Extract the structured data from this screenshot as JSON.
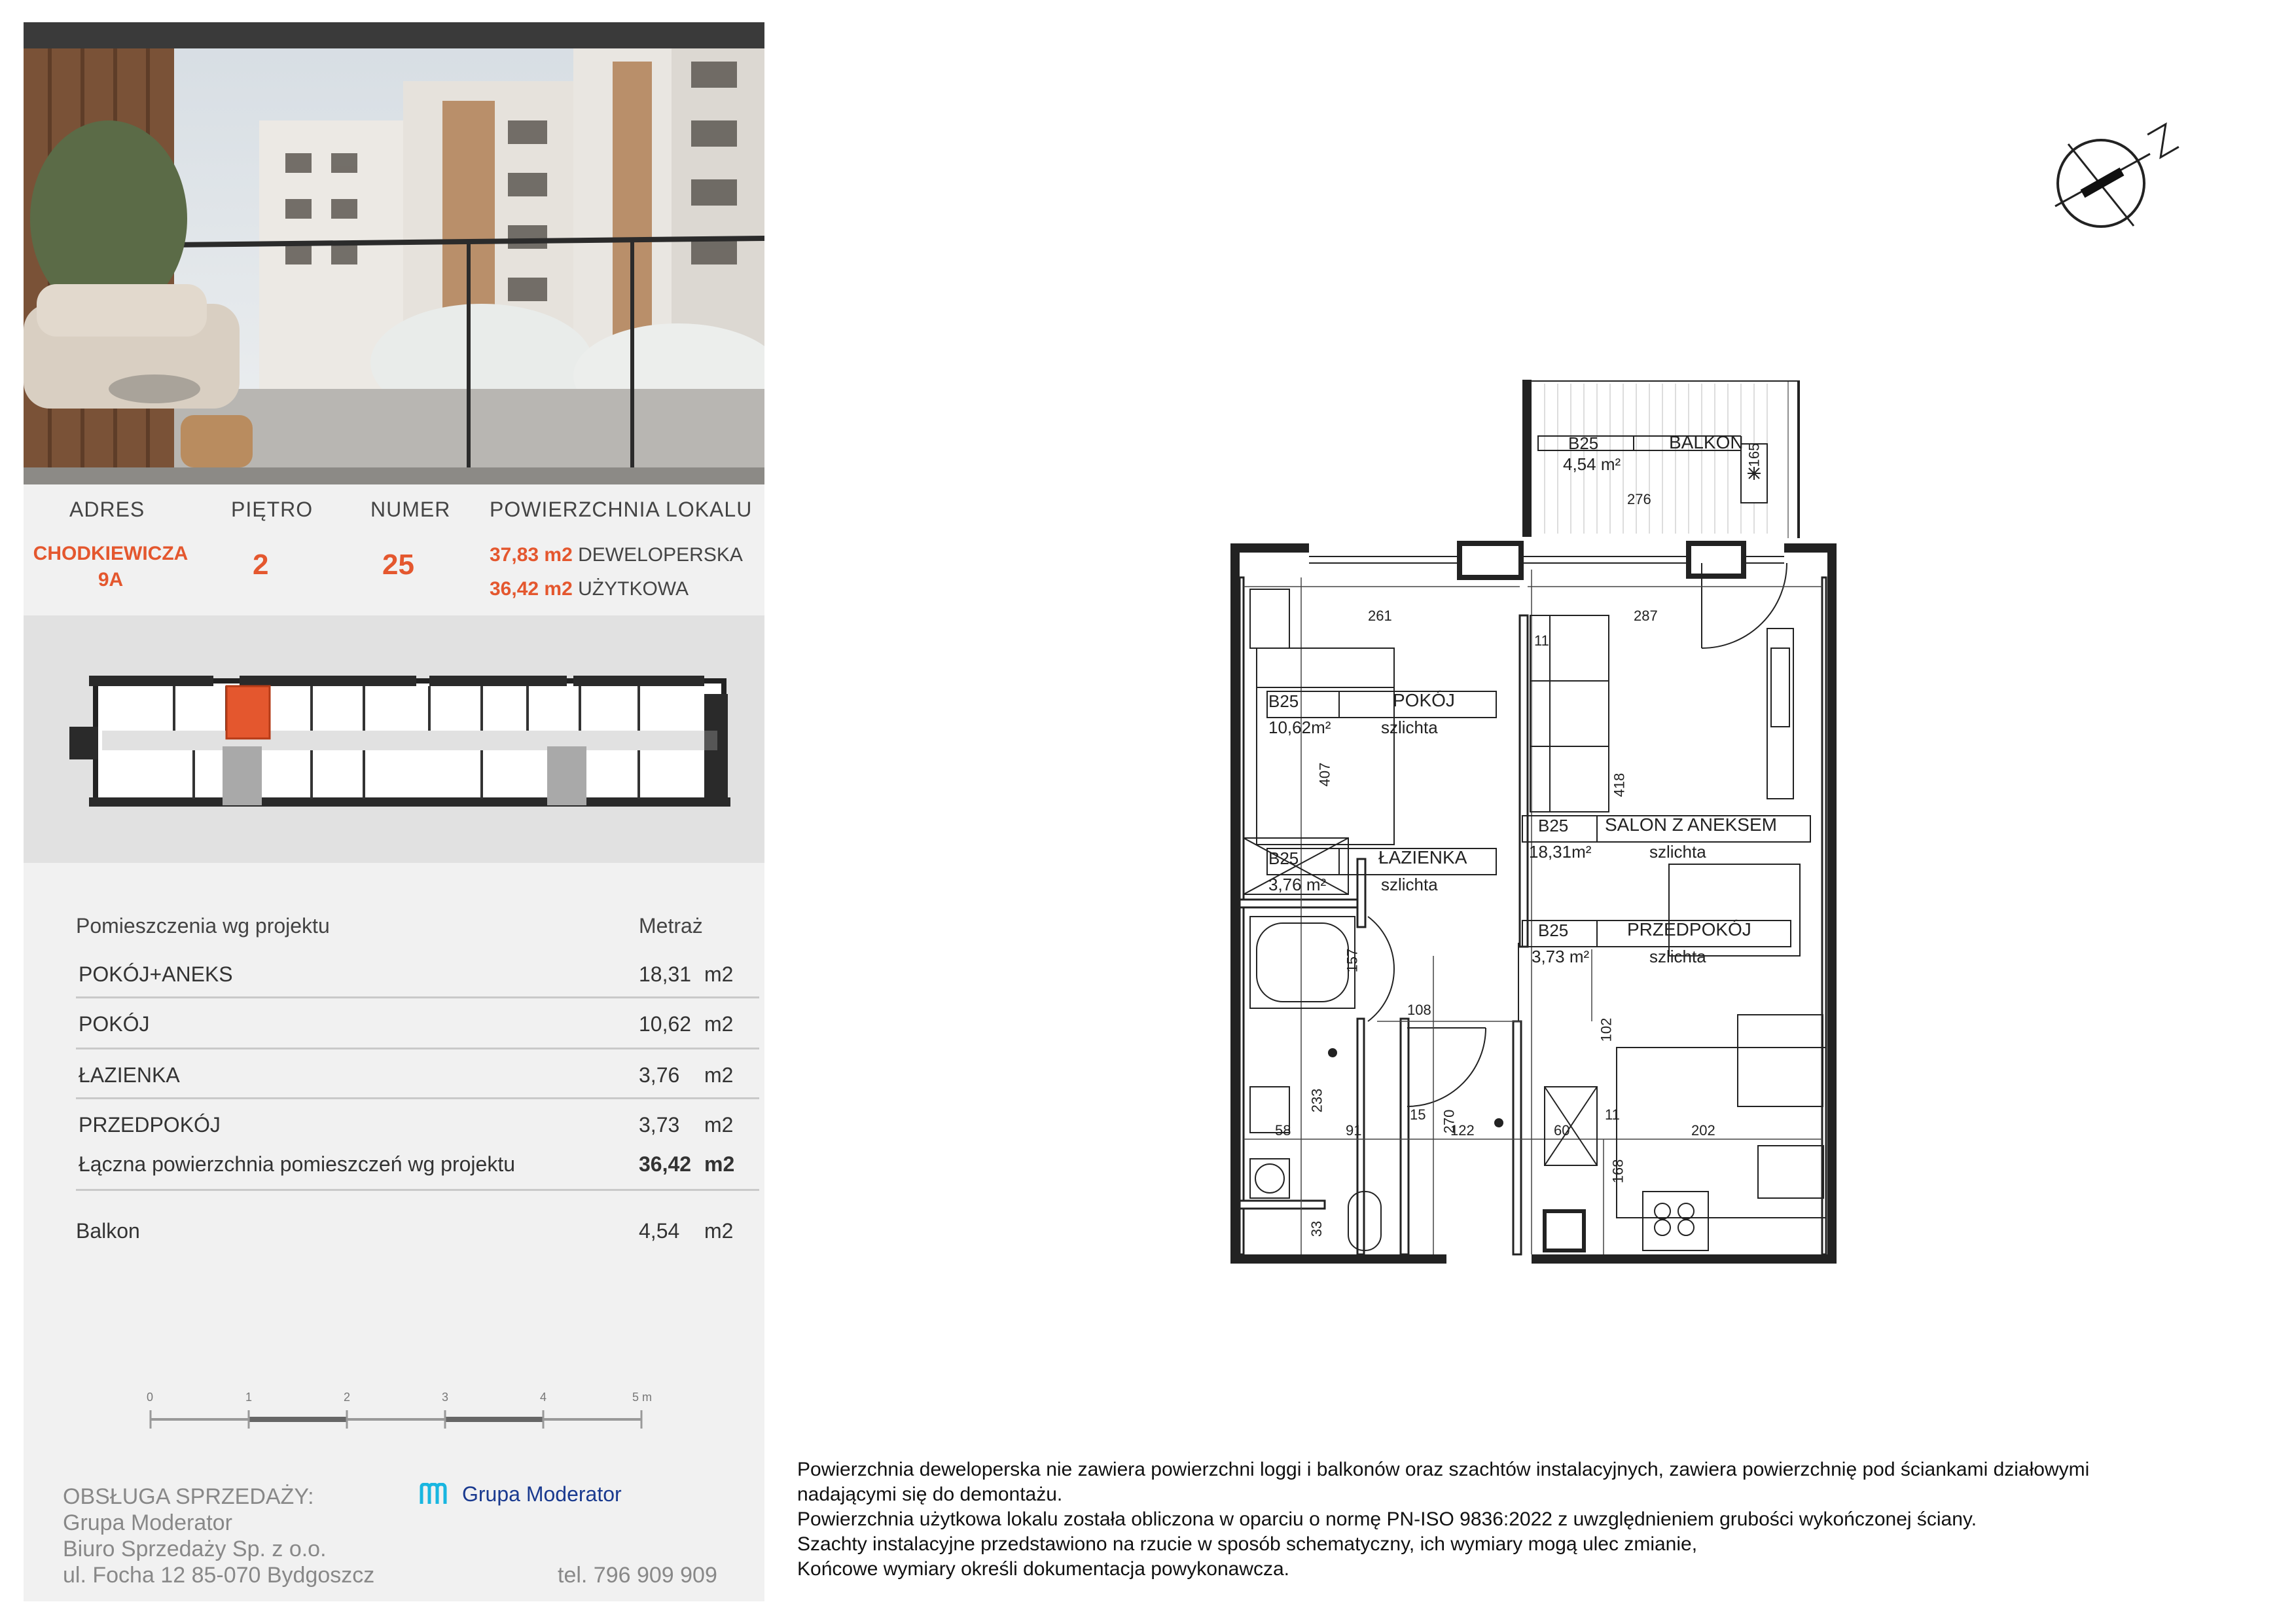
{
  "header": {
    "address_label": "ADRES",
    "floor_label": "PIĘTRO",
    "number_label": "NUMER",
    "area_label": "POWIERZCHNIA LOKALU",
    "address_line1": "CHODKIEWICZA",
    "address_line2": "9A",
    "floor": "2",
    "number": "25",
    "area_dev_value": "37,83 m2",
    "area_dev_label": "DEWELOPERSKA",
    "area_use_value": "36,42 m2",
    "area_use_label": "UŻYTKOWA"
  },
  "rooms_table": {
    "col_rooms": "Pomieszczenia wg projektu",
    "col_area": "Metraż",
    "rows": [
      {
        "name": "POKÓJ+ANEKS",
        "area": "18,31",
        "unit": "m2"
      },
      {
        "name": "POKÓJ",
        "area": "10,62",
        "unit": "m2"
      },
      {
        "name": "ŁAZIENKA",
        "area": "3,76",
        "unit": "m2"
      },
      {
        "name": "PRZEDPOKÓJ",
        "area": "3,73",
        "unit": "m2"
      }
    ],
    "total_label": "Łączna powierzchnia pomieszczeń wg projektu",
    "total_area": "36,42",
    "total_unit": "m2",
    "balcony_label": "Balkon",
    "balcony_area": "4,54",
    "balcony_unit": "m2"
  },
  "scale_bar": {
    "ticks": [
      "0",
      "1",
      "2",
      "3",
      "4",
      "5 m"
    ]
  },
  "sales": {
    "heading": "OBSŁUGA SPRZEDAŻY:",
    "line1": "Grupa Moderator",
    "line2": "Biuro Sprzedaży Sp. z o.o.",
    "line3": "ul. Focha 12 85-070 Bydgoszcz",
    "phone": "tel. 796 909 909",
    "logo_text": "Grupa Moderator"
  },
  "compass": {
    "label": "N"
  },
  "plan": {
    "balkon": {
      "code": "B25",
      "name": "BALKON",
      "area": "4,54 m²"
    },
    "pokoj": {
      "code": "B25",
      "name": "POKÓJ",
      "area": "10,62m²",
      "finish": "szlichta"
    },
    "lazienka": {
      "code": "B25",
      "name": "ŁAZIENKA",
      "area": "3,76 m²",
      "finish": "szlichta"
    },
    "salon": {
      "code": "B25",
      "name": "SALON Z ANEKSEM",
      "area": "18,31m²",
      "finish": "szlichta"
    },
    "przedpokoj": {
      "code": "B25",
      "name": "PRZEDPOKÓJ",
      "area": "3,73 m²",
      "finish": "szlichta"
    },
    "dims": [
      "261",
      "287",
      "276",
      "165",
      "11",
      "407",
      "418",
      "157",
      "108",
      "102",
      "233",
      "270",
      "15",
      "11",
      "58",
      "91",
      "122",
      "60",
      "202",
      "168",
      "33"
    ]
  },
  "notes": [
    "Powierzchnia deweloperska nie zawiera powierzchni loggi i balkonów oraz szachtów instalacyjnych, zawiera powierzchnię pod ściankami działowymi",
    "nadającymi się do demontażu.",
    "Powierzchnia użytkowa lokalu została obliczona w oparciu o normę PN-ISO 9836:2022 z uwzględnieniem grubości wykończonej ściany.",
    "Szachty instalacyjne przedstawiono na rzucie w sposób schematyczny, ich wymiary mogą ulec zmianie,",
    "Końcowe wymiary określi dokumentacja powykonawcza."
  ],
  "colors": {
    "accent": "#e4572e",
    "keyplan_highlight": "#e4572e",
    "brand_blue": "#1a3a8f",
    "brand_cyan": "#19b6e0"
  }
}
